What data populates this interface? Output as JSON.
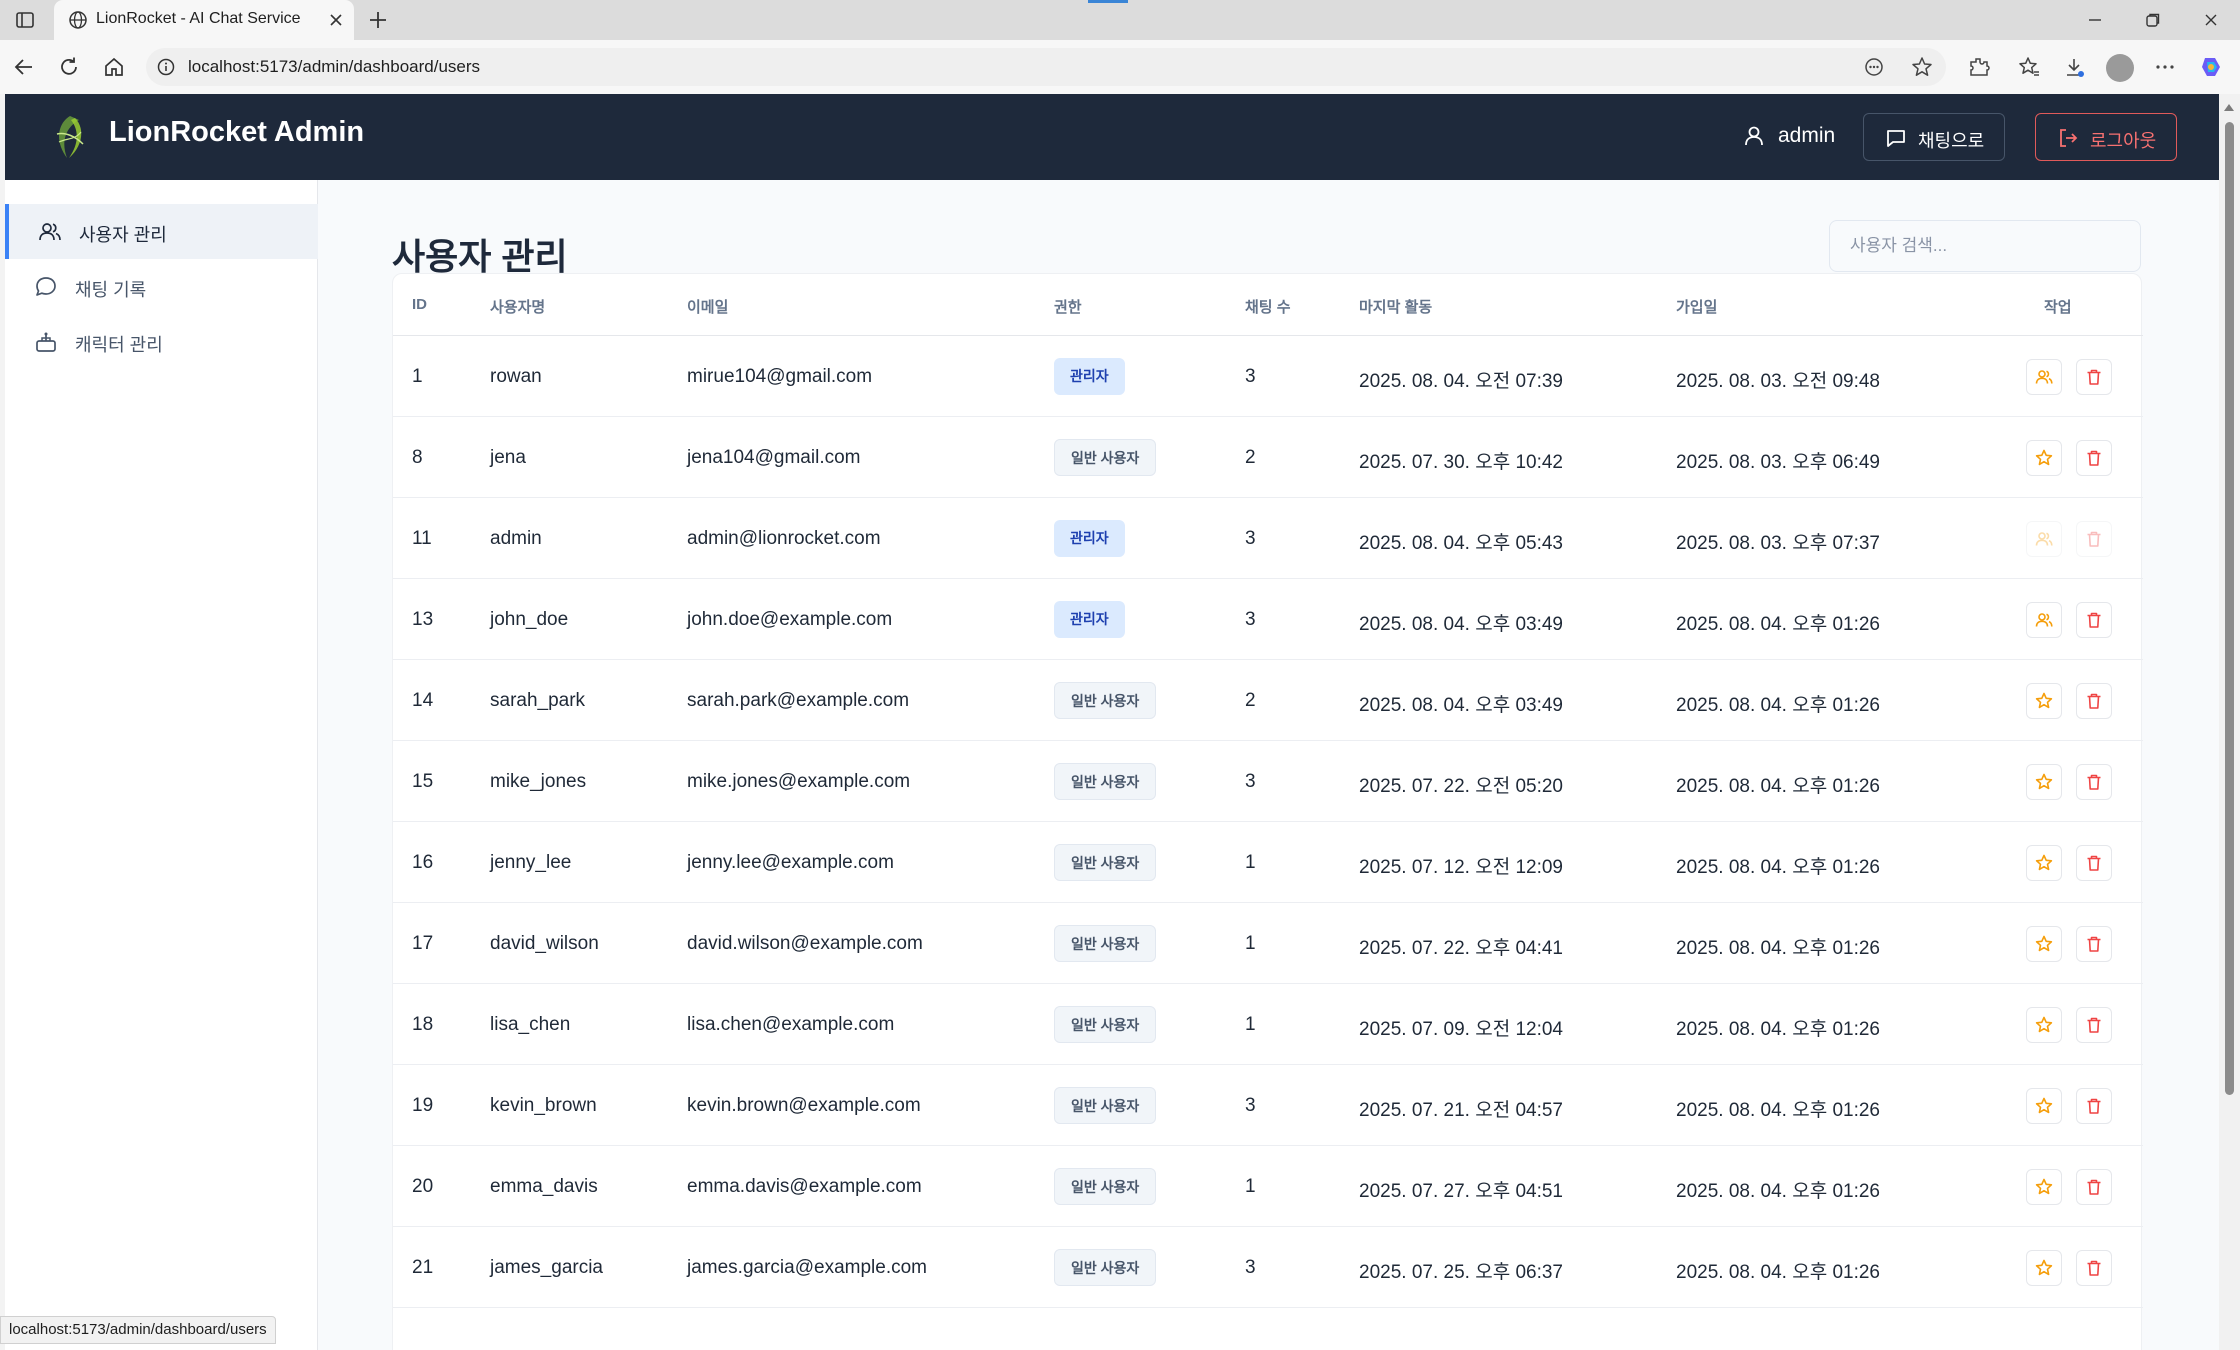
{
  "browser": {
    "tab_title": "LionRocket - AI Chat Service",
    "url": "localhost:5173/admin/dashboard/users",
    "status_url": "localhost:5173/admin/dashboard/users"
  },
  "header": {
    "brand": "LionRocket Admin",
    "user": "admin",
    "chat_button": "채팅으로",
    "logout_button": "로그아웃"
  },
  "sidebar": {
    "items": [
      {
        "label": "사용자 관리",
        "icon": "users-icon",
        "active": true
      },
      {
        "label": "채팅 기록",
        "icon": "message-icon",
        "active": false
      },
      {
        "label": "캐릭터 관리",
        "icon": "bot-icon",
        "active": false
      }
    ]
  },
  "main": {
    "title": "사용자 관리",
    "search_placeholder": "사용자 검색..."
  },
  "table": {
    "columns": [
      "ID",
      "사용자명",
      "이메일",
      "권한",
      "채팅 수",
      "마지막 활동",
      "가입일",
      "작업"
    ],
    "rows": [
      {
        "id": "1",
        "username": "rowan",
        "email": "mirue104@gmail.com",
        "role": "관리자",
        "role_type": "admin",
        "chats": "3",
        "last_active": "2025. 08. 04. 오전 07:39",
        "joined": "2025. 08. 03. 오전 09:48",
        "disabled": false
      },
      {
        "id": "8",
        "username": "jena",
        "email": "jena104@gmail.com",
        "role": "일반 사용자",
        "role_type": "user",
        "chats": "2",
        "last_active": "2025. 07. 30. 오후 10:42",
        "joined": "2025. 08. 03. 오후 06:49",
        "disabled": false
      },
      {
        "id": "11",
        "username": "admin",
        "email": "admin@lionrocket.com",
        "role": "관리자",
        "role_type": "admin",
        "chats": "3",
        "last_active": "2025. 08. 04. 오후 05:43",
        "joined": "2025. 08. 03. 오후 07:37",
        "disabled": true
      },
      {
        "id": "13",
        "username": "john_doe",
        "email": "john.doe@example.com",
        "role": "관리자",
        "role_type": "admin",
        "chats": "3",
        "last_active": "2025. 08. 04. 오후 03:49",
        "joined": "2025. 08. 04. 오후 01:26",
        "disabled": false
      },
      {
        "id": "14",
        "username": "sarah_park",
        "email": "sarah.park@example.com",
        "role": "일반 사용자",
        "role_type": "user",
        "chats": "2",
        "last_active": "2025. 08. 04. 오후 03:49",
        "joined": "2025. 08. 04. 오후 01:26",
        "disabled": false
      },
      {
        "id": "15",
        "username": "mike_jones",
        "email": "mike.jones@example.com",
        "role": "일반 사용자",
        "role_type": "user",
        "chats": "3",
        "last_active": "2025. 07. 22. 오전 05:20",
        "joined": "2025. 08. 04. 오후 01:26",
        "disabled": false
      },
      {
        "id": "16",
        "username": "jenny_lee",
        "email": "jenny.lee@example.com",
        "role": "일반 사용자",
        "role_type": "user",
        "chats": "1",
        "last_active": "2025. 07. 12. 오전 12:09",
        "joined": "2025. 08. 04. 오후 01:26",
        "disabled": false
      },
      {
        "id": "17",
        "username": "david_wilson",
        "email": "david.wilson@example.com",
        "role": "일반 사용자",
        "role_type": "user",
        "chats": "1",
        "last_active": "2025. 07. 22. 오후 04:41",
        "joined": "2025. 08. 04. 오후 01:26",
        "disabled": false
      },
      {
        "id": "18",
        "username": "lisa_chen",
        "email": "lisa.chen@example.com",
        "role": "일반 사용자",
        "role_type": "user",
        "chats": "1",
        "last_active": "2025. 07. 09. 오전 12:04",
        "joined": "2025. 08. 04. 오후 01:26",
        "disabled": false
      },
      {
        "id": "19",
        "username": "kevin_brown",
        "email": "kevin.brown@example.com",
        "role": "일반 사용자",
        "role_type": "user",
        "chats": "3",
        "last_active": "2025. 07. 21. 오전 04:57",
        "joined": "2025. 08. 04. 오후 01:26",
        "disabled": false
      },
      {
        "id": "20",
        "username": "emma_davis",
        "email": "emma.davis@example.com",
        "role": "일반 사용자",
        "role_type": "user",
        "chats": "1",
        "last_active": "2025. 07. 27. 오후 04:51",
        "joined": "2025. 08. 04. 오후 01:26",
        "disabled": false
      },
      {
        "id": "21",
        "username": "james_garcia",
        "email": "james.garcia@example.com",
        "role": "일반 사용자",
        "role_type": "user",
        "chats": "3",
        "last_active": "2025. 07. 25. 오후 06:37",
        "joined": "2025. 08. 04. 오후 01:26",
        "disabled": false
      }
    ]
  },
  "colors": {
    "header_bg": "#1e293b",
    "accent": "#3b82f6",
    "admin_action": "#f59e0b",
    "delete_action": "#ef4444"
  }
}
